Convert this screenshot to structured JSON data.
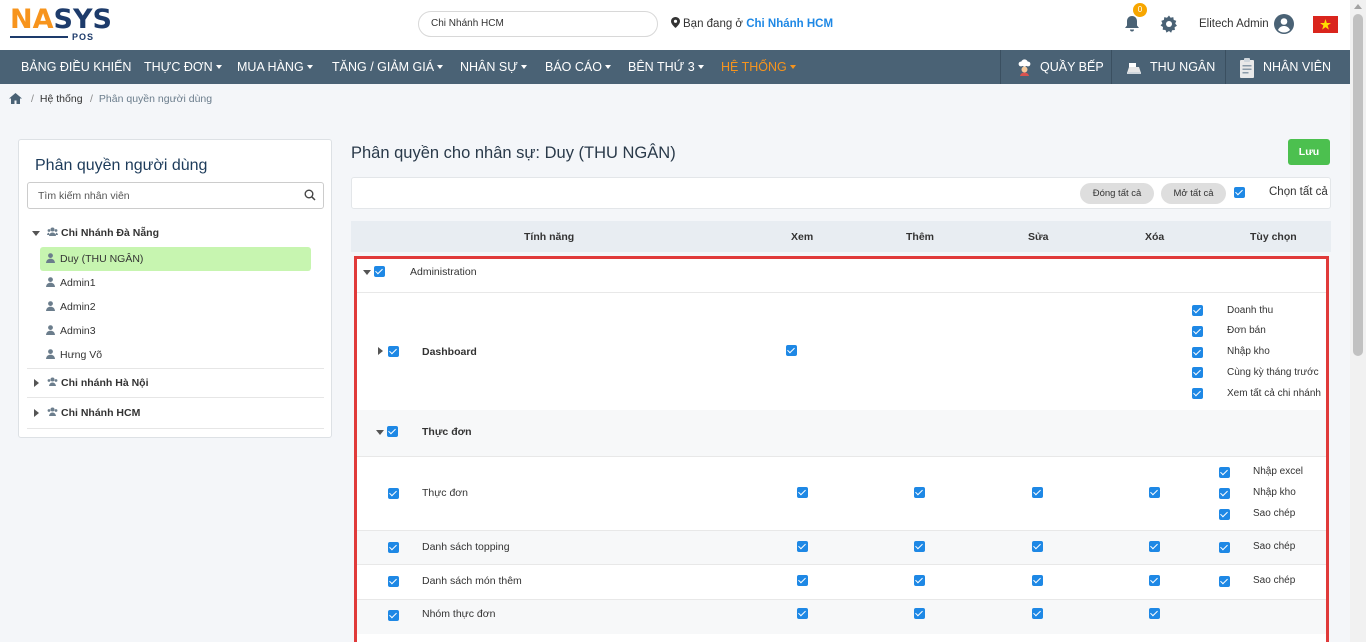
{
  "logo": {
    "na": "NA",
    "sys": "SYS",
    "sub": "POS"
  },
  "header": {
    "branch_value": "Chi Nhánh HCM",
    "location_prefix": "Bạn đang ở",
    "location_branch": "Chi Nhánh HCM",
    "notification_count": "0",
    "user_name": "Elitech Admin"
  },
  "nav": {
    "items": [
      {
        "label": "BẢNG ĐIỀU KHIỂN"
      },
      {
        "label": "THỰC ĐƠN"
      },
      {
        "label": "MUA HÀNG"
      },
      {
        "label": "TĂNG / GIẢM GIÁ"
      },
      {
        "label": "NHÂN SỰ"
      },
      {
        "label": "BÁO CÁO"
      },
      {
        "label": "BÊN THỨ 3"
      },
      {
        "label": "HỆ THỐNG"
      }
    ],
    "right": [
      {
        "label": "QUẦY BẾP"
      },
      {
        "label": "THU NGÂN"
      },
      {
        "label": "NHÂN VIÊN"
      }
    ],
    "active_color": "#f7941d",
    "bg_color": "#4a6275"
  },
  "breadcrumb": {
    "item1": "Hệ thống",
    "item2": "Phân quyền người dùng",
    "sep": "/"
  },
  "left_panel": {
    "title": "Phân quyền người dùng",
    "search_placeholder": "Tìm kiếm nhân viên",
    "groups": [
      {
        "name": "Chi Nhánh Đà Nẵng",
        "users": [
          "Duy (THU NGÂN)",
          "Admin1",
          "Admin2",
          "Admin3",
          "Hưng Võ"
        ]
      },
      {
        "name": "Chi nhánh Hà Nội"
      },
      {
        "name": "Chi Nhánh HCM"
      }
    ]
  },
  "right_panel": {
    "title": "Phân quyền cho nhân sự: Duy (THU NGÂN)",
    "save_label": "Lưu",
    "collapse_all": "Đóng tất cả",
    "expand_all": "Mở tất cả",
    "select_all": "Chọn tất cả"
  },
  "table": {
    "headers": {
      "feature": "Tính năng",
      "view": "Xem",
      "add": "Thêm",
      "edit": "Sửa",
      "delete": "Xóa",
      "options": "Tùy chọn"
    },
    "administration": "Administration",
    "dashboard": {
      "label": "Dashboard",
      "options": [
        "Doanh thu",
        "Đơn bán",
        "Nhập kho",
        "Cùng kỳ tháng trước",
        "Xem tất cả chi nhánh"
      ]
    },
    "menu_group": "Thực đơn",
    "rows": [
      {
        "label": "Thực đơn",
        "options": [
          "Nhập excel",
          "Nhập kho",
          "Sao chép"
        ]
      },
      {
        "label": "Danh sách topping",
        "options": [
          "Sao chép"
        ]
      },
      {
        "label": "Danh sách món thêm",
        "options": [
          "Sao chép"
        ]
      },
      {
        "label": "Nhóm thực đơn",
        "options": []
      }
    ]
  }
}
